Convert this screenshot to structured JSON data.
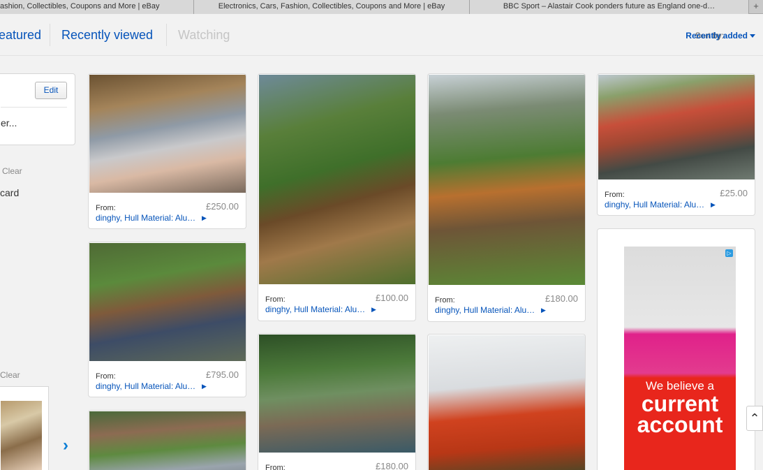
{
  "browser": {
    "tabs": [
      "ashion, Collectibles, Coupons and More | eBay",
      "Electronics, Cars, Fashion, Collectibles, Coupons and More | eBay",
      "BBC Sport – Alastair Cook ponders future as England one-d…"
    ],
    "new_tab": "+"
  },
  "feed": {
    "tabs": [
      "eatured",
      "Recently viewed",
      "Watching"
    ],
    "sort_label": "Sort by:",
    "sort_value": "Recently added"
  },
  "sidebar": {
    "edit_label": "Edit",
    "filter_text": "er...",
    "clear_label": "Clear",
    "card_text": "card",
    "clear2_label": "Clear",
    "next_glyph": "›"
  },
  "items": [
    {
      "from": "From:",
      "price": "£250.00",
      "title": "dinghy, Hull Material: Alu…"
    },
    {
      "from": "From:",
      "price": "£100.00",
      "title": "dinghy, Hull Material: Alu…"
    },
    {
      "from": "From:",
      "price": "£180.00",
      "title": "dinghy, Hull Material: Alu…"
    },
    {
      "from": "From:",
      "price": "£25.00",
      "title": "dinghy, Hull Material: Alu…"
    },
    {
      "from": "From:",
      "price": "£795.00",
      "title": "dinghy, Hull Material: Alu…"
    },
    {
      "from": "From:",
      "price": "£180.00"
    }
  ],
  "ad": {
    "badge": "▷",
    "line1": "We believe a",
    "line2": "current",
    "line3": "account"
  },
  "scroll_top_glyph": "⌃"
}
